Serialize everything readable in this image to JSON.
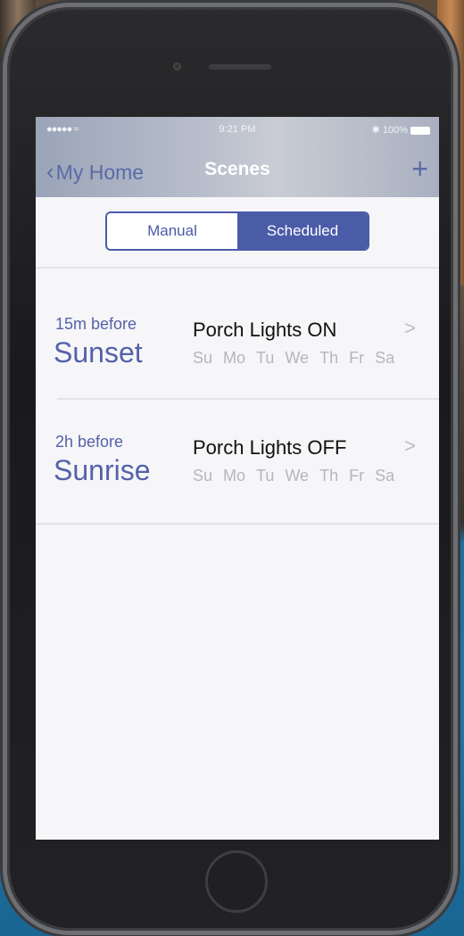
{
  "status_bar": {
    "signal": "●●●●● ≈",
    "time": "9:21 PM",
    "battery": "✱ 100%"
  },
  "nav": {
    "back_label": "My Home",
    "title": "Scenes",
    "add_label": "+"
  },
  "segment": {
    "manual_label": "Manual",
    "scheduled_label": "Scheduled",
    "selected": "Scheduled"
  },
  "schedules": [
    {
      "offset": "15m before",
      "event": "Sunset",
      "scene": "Porch Lights ON",
      "days": [
        "Su",
        "Mo",
        "Tu",
        "We",
        "Th",
        "Fr",
        "Sa"
      ]
    },
    {
      "offset": "2h before",
      "event": "Sunrise",
      "scene": "Porch Lights OFF",
      "days": [
        "Su",
        "Mo",
        "Tu",
        "We",
        "Th",
        "Fr",
        "Sa"
      ]
    }
  ],
  "colors": {
    "accent": "#4a5ba8",
    "day_inactive": "#b4b6bd"
  }
}
